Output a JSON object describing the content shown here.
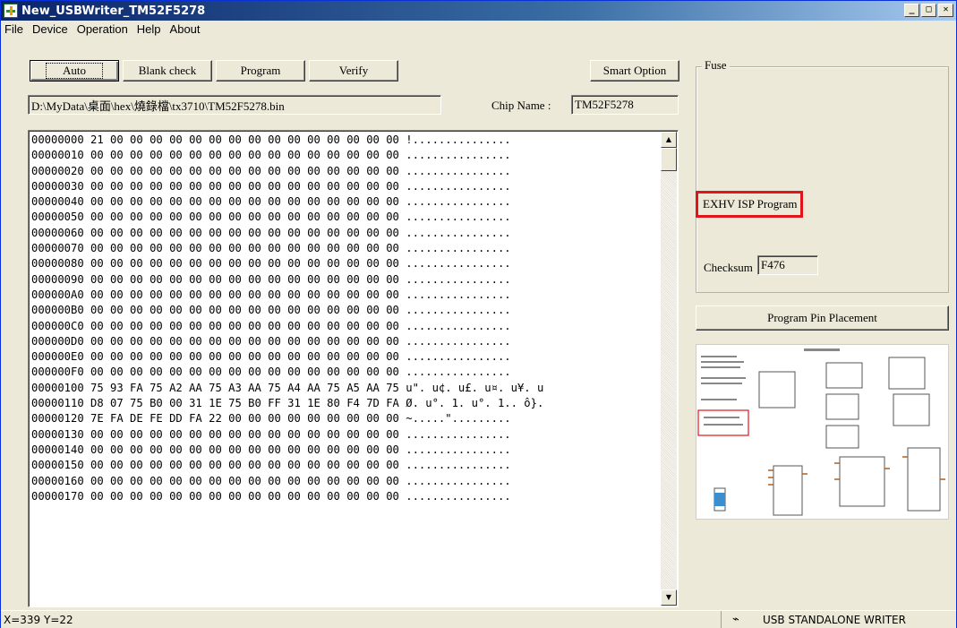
{
  "window": {
    "title": "New_USBWriter_TM52F5278"
  },
  "menu": [
    "File",
    "Device",
    "Operation",
    "Help",
    "About"
  ],
  "toolbar": {
    "auto": "Auto",
    "blank_check": "Blank check",
    "program": "Program",
    "verify": "Verify",
    "smart_option": "Smart Option"
  },
  "file_path": "D:\\MyData\\桌面\\hex\\燒錄檔\\tx3710\\TM52F5278.bin",
  "chip": {
    "label": "Chip Name :",
    "value": "TM52F5278"
  },
  "hex_rows": [
    "00000000 21 00 00 00 00 00 00 00 00 00 00 00 00 00 00 00 !...............",
    "00000010 00 00 00 00 00 00 00 00 00 00 00 00 00 00 00 00 ................",
    "00000020 00 00 00 00 00 00 00 00 00 00 00 00 00 00 00 00 ................",
    "00000030 00 00 00 00 00 00 00 00 00 00 00 00 00 00 00 00 ................",
    "00000040 00 00 00 00 00 00 00 00 00 00 00 00 00 00 00 00 ................",
    "00000050 00 00 00 00 00 00 00 00 00 00 00 00 00 00 00 00 ................",
    "00000060 00 00 00 00 00 00 00 00 00 00 00 00 00 00 00 00 ................",
    "00000070 00 00 00 00 00 00 00 00 00 00 00 00 00 00 00 00 ................",
    "00000080 00 00 00 00 00 00 00 00 00 00 00 00 00 00 00 00 ................",
    "00000090 00 00 00 00 00 00 00 00 00 00 00 00 00 00 00 00 ................",
    "000000A0 00 00 00 00 00 00 00 00 00 00 00 00 00 00 00 00 ................",
    "000000B0 00 00 00 00 00 00 00 00 00 00 00 00 00 00 00 00 ................",
    "000000C0 00 00 00 00 00 00 00 00 00 00 00 00 00 00 00 00 ................",
    "000000D0 00 00 00 00 00 00 00 00 00 00 00 00 00 00 00 00 ................",
    "000000E0 00 00 00 00 00 00 00 00 00 00 00 00 00 00 00 00 ................",
    "000000F0 00 00 00 00 00 00 00 00 00 00 00 00 00 00 00 00 ................",
    "00000100 75 93 FA 75 A2 AA 75 A3 AA 75 A4 AA 75 A5 AA 75 u\". u¢. u£. u¤. u¥. u",
    "00000110 D8 07 75 B0 00 31 1E 75 B0 FF 31 1E 80 F4 7D FA Ø. u°. 1. u°. 1.. ô}.",
    "00000120 7E FA DE FE DD FA 22 00 00 00 00 00 00 00 00 00 ~.....\".........",
    "00000130 00 00 00 00 00 00 00 00 00 00 00 00 00 00 00 00 ................",
    "00000140 00 00 00 00 00 00 00 00 00 00 00 00 00 00 00 00 ................",
    "00000150 00 00 00 00 00 00 00 00 00 00 00 00 00 00 00 00 ................",
    "00000160 00 00 00 00 00 00 00 00 00 00 00 00 00 00 00 00 ................",
    "00000170 00 00 00 00 00 00 00 00 00 00 00 00 00 00 00 00 ................"
  ],
  "fuse": {
    "group_label": "Fuse",
    "exhv_label": "EXHV ISP Program",
    "checksum_label": "Checksum",
    "checksum_value": "F476"
  },
  "pin_button": "Program Pin Placement",
  "status": {
    "coords": "X=339 Y=22",
    "mode": "USB STANDALONE WRITER"
  },
  "icons": [
    "app-icon",
    "usb-icon",
    "scroll-up-icon",
    "scroll-down-icon"
  ],
  "colors": {
    "highlight_red": "#e0141a",
    "title_blue": "#0a246a"
  }
}
